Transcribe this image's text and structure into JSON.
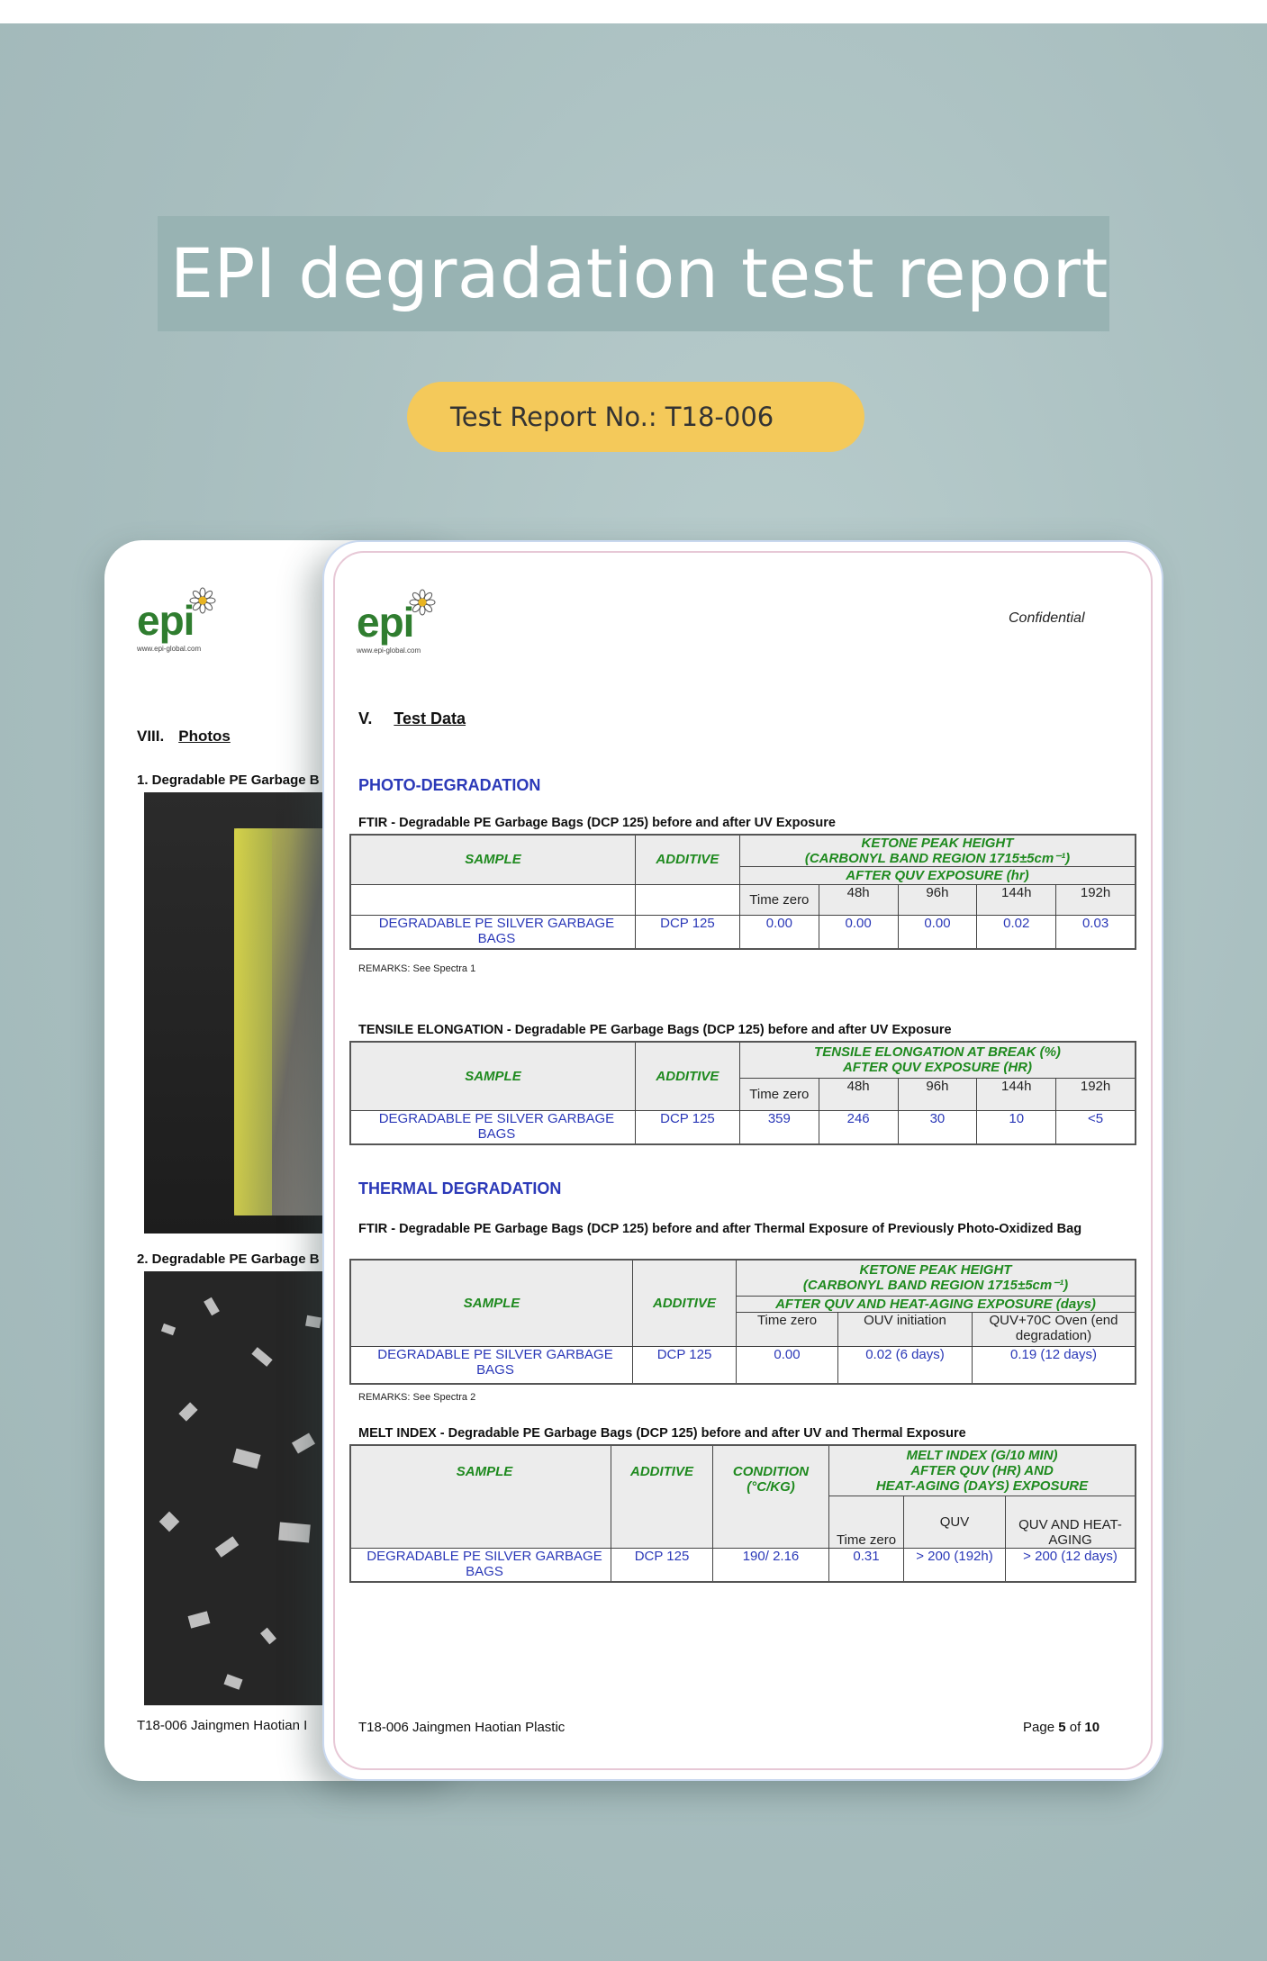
{
  "header": {
    "title": "EPI degradation test report",
    "report_no": "Test Report No.: T18-006"
  },
  "back_page": {
    "logo_text": "epi",
    "logo_url": "www.epi-global.com",
    "section": "VIII.",
    "section_title": "Photos",
    "caption1": "1. Degradable PE Garbage B",
    "caption2": "2. Degradable PE Garbage B",
    "footer": "T18-006 Jaingmen Haotian I"
  },
  "front_page": {
    "logo_text": "epi",
    "logo_url": "www.epi-global.com",
    "confidential": "Confidential",
    "section": "V.",
    "section_title": "Test Data",
    "photo_heading": "PHOTO-DEGRADATION",
    "thermal_heading": "THERMAL DEGRADATION",
    "footer_left": "T18-006 Jaingmen Haotian Plastic",
    "footer_page_prefix": "Page",
    "footer_page_num": "5",
    "footer_page_of": "of",
    "footer_page_total": "10"
  },
  "table1": {
    "caption": "FTIR - Degradable PE Garbage Bags (DCP 125) before and after UV Exposure",
    "sample_h": "SAMPLE",
    "additive_h": "ADDITIVE",
    "group_h1": "KETONE PEAK HEIGHT",
    "group_h2": "(CARBONYL BAND REGION 1715±5cm⁻¹)",
    "group_h3": "AFTER QUV EXPOSURE (hr)",
    "cols": [
      "Time zero",
      "48h",
      "96h",
      "144h",
      "192h"
    ],
    "sample": "DEGRADABLE PE SILVER GARBAGE BAGS",
    "additive": "DCP 125",
    "values": [
      "0.00",
      "0.00",
      "0.00",
      "0.02",
      "0.03"
    ],
    "remarks": "REMARKS: See Spectra 1"
  },
  "table2": {
    "caption": "TENSILE ELONGATION - Degradable PE Garbage Bags (DCP 125) before and after UV Exposure",
    "sample_h": "SAMPLE",
    "additive_h": "ADDITIVE",
    "group_h1": "TENSILE ELONGATION AT BREAK (%)",
    "group_h2": "AFTER QUV EXPOSURE (HR)",
    "cols": [
      "Time zero",
      "48h",
      "96h",
      "144h",
      "192h"
    ],
    "sample": "DEGRADABLE PE SILVER GARBAGE BAGS",
    "additive": "DCP 125",
    "values": [
      "359",
      "246",
      "30",
      "10",
      "<5"
    ]
  },
  "table3": {
    "caption": "FTIR - Degradable PE Garbage Bags (DCP 125) before and after Thermal Exposure of Previously Photo-Oxidized Bag",
    "sample_h": "SAMPLE",
    "additive_h": "ADDITIVE",
    "group_h1": "KETONE PEAK HEIGHT",
    "group_h2": "(CARBONYL BAND REGION 1715±5cm⁻¹)",
    "group_h3": "AFTER QUV AND HEAT-AGING EXPOSURE (days)",
    "cols": [
      "Time zero",
      "OUV initiation",
      "QUV+70C Oven (end degradation)"
    ],
    "sample": "DEGRADABLE PE SILVER GARBAGE BAGS",
    "additive": "DCP 125",
    "values": [
      "0.00",
      "0.02 (6 days)",
      "0.19 (12 days)"
    ],
    "remarks": "REMARKS: See Spectra 2"
  },
  "table4": {
    "caption": "MELT INDEX - Degradable PE Garbage Bags (DCP 125) before and after UV and Thermal Exposure",
    "sample_h": "SAMPLE",
    "additive_h": "ADDITIVE",
    "condition_h": "CONDITION (°C/KG)",
    "group_h1": "MELT INDEX (G/10 MIN)",
    "group_h2": "AFTER QUV (HR) AND",
    "group_h3": "HEAT-AGING (DAYS) EXPOSURE",
    "cols": [
      "Time zero",
      "QUV",
      "QUV AND HEAT-AGING"
    ],
    "sample": "DEGRADABLE PE SILVER GARBAGE BAGS",
    "additive": "DCP 125",
    "condition": "190/ 2.16",
    "values": [
      "0.31",
      "> 200 (192h)",
      "> 200 (12 days)"
    ]
  }
}
